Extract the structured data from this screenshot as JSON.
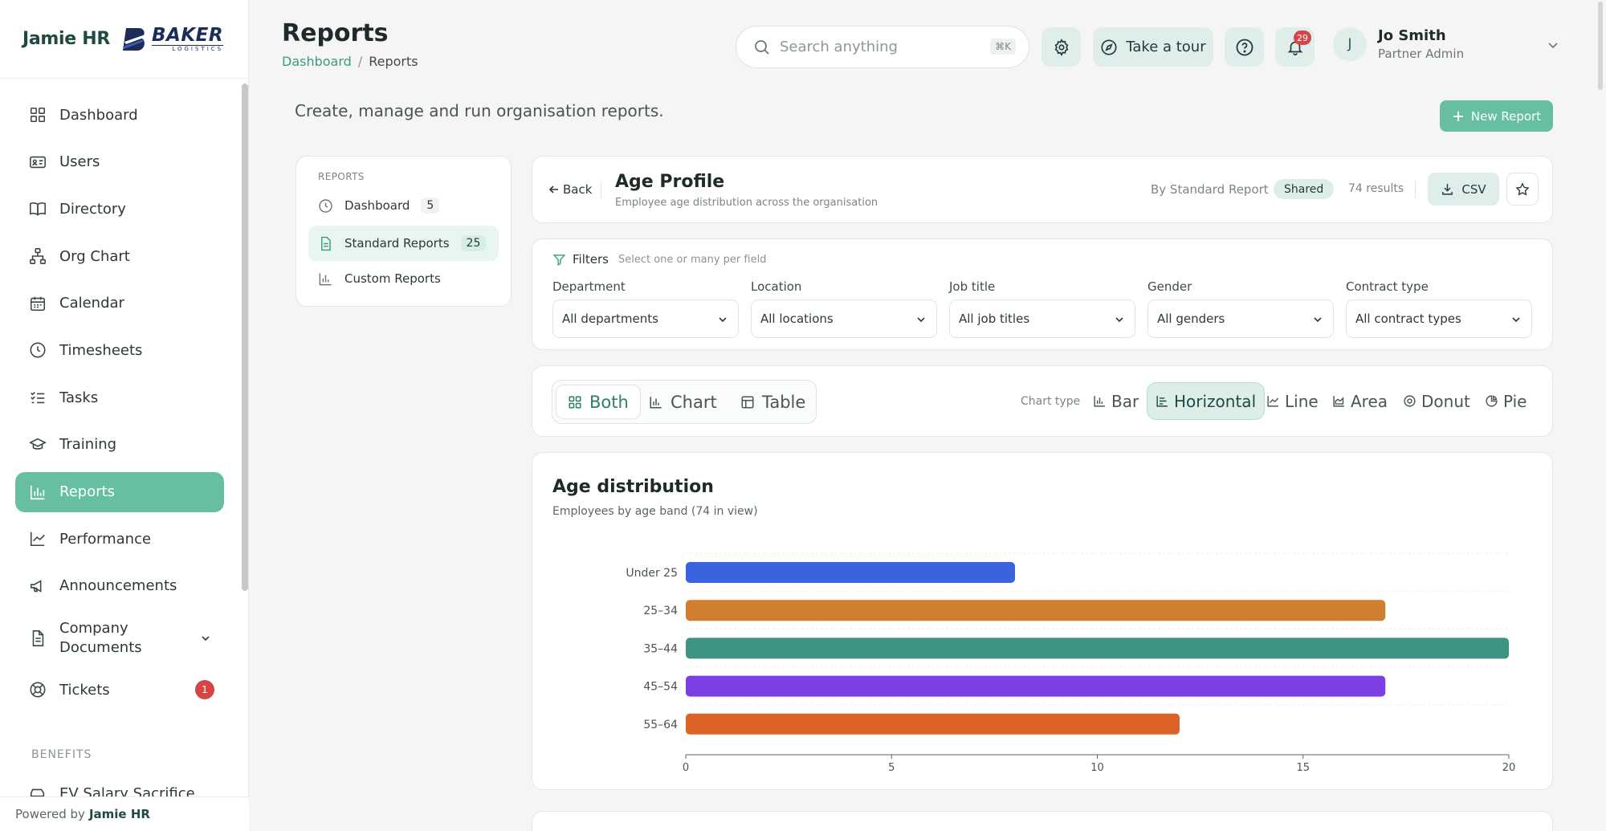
{
  "brand": {
    "name": "Jamie HR",
    "partner_logo_main": "BAKER",
    "partner_logo_sub": "LOGISTICS"
  },
  "sidebar": {
    "items": [
      {
        "label": "Dashboard",
        "icon": "grid-icon"
      },
      {
        "label": "Users",
        "icon": "id-card-icon"
      },
      {
        "label": "Directory",
        "icon": "book-icon"
      },
      {
        "label": "Org Chart",
        "icon": "org-chart-icon"
      },
      {
        "label": "Calendar",
        "icon": "calendar-icon"
      },
      {
        "label": "Timesheets",
        "icon": "clock-icon"
      },
      {
        "label": "Tasks",
        "icon": "checklist-icon"
      },
      {
        "label": "Training",
        "icon": "graduation-cap-icon"
      },
      {
        "label": "Reports",
        "icon": "bar-chart-icon",
        "active": true
      },
      {
        "label": "Performance",
        "icon": "line-chart-icon"
      },
      {
        "label": "Announcements",
        "icon": "megaphone-icon"
      },
      {
        "label": "Company Documents",
        "icon": "document-icon"
      },
      {
        "label": "Tickets",
        "icon": "lifebuoy-icon",
        "badge": "1"
      }
    ],
    "section_benefits": "BENEFITS",
    "cut_item": "EV Salary Sacrifice",
    "powered_by": "Powered by",
    "powered_brand": "Jamie HR"
  },
  "header": {
    "title": "Reports",
    "breadcrumb": [
      "Dashboard",
      "/",
      "Reports"
    ],
    "search_placeholder": "Search anything",
    "search_shortcut": "⌘K",
    "tour_label": "Take a tour",
    "notifications_count": "29",
    "user": {
      "initial": "J",
      "name": "Jo Smith",
      "role": "Partner Admin"
    }
  },
  "page": {
    "subtitle": "Create, manage and run organisation reports.",
    "new_report_label": "New Report"
  },
  "reports_nav": {
    "heading": "REPORTS",
    "items": [
      {
        "label": "Dashboard",
        "count": "5"
      },
      {
        "label": "Standard Reports",
        "count": "25",
        "active": true
      },
      {
        "label": "Custom Reports"
      }
    ]
  },
  "report": {
    "back_label": "Back",
    "title": "Age Profile",
    "description": "Employee age distribution across the organisation",
    "by": "By Standard Report",
    "shared": "Shared",
    "results": "74 results",
    "csv_label": "CSV"
  },
  "filters": {
    "title": "Filters",
    "hint": "Select one or many per field",
    "fields": [
      {
        "label": "Department",
        "value": "All departments"
      },
      {
        "label": "Location",
        "value": "All locations"
      },
      {
        "label": "Job title",
        "value": "All job titles"
      },
      {
        "label": "Gender",
        "value": "All genders"
      },
      {
        "label": "Contract type",
        "value": "All contract types"
      }
    ]
  },
  "view": {
    "modes": [
      "Both",
      "Chart",
      "Table"
    ],
    "active_mode": "Both",
    "chart_type_label": "Chart type",
    "chart_types": [
      "Bar",
      "Horizontal",
      "Line",
      "Area",
      "Donut",
      "Pie"
    ],
    "active_chart_type": "Horizontal"
  },
  "chart_panel": {
    "title": "Age distribution",
    "subtitle": "Employees by age band (74 in view)"
  },
  "chart_data": {
    "type": "bar",
    "orientation": "horizontal",
    "categories": [
      "Under 25",
      "25–34",
      "35–44",
      "45–54",
      "55–64"
    ],
    "values": [
      8,
      17,
      20,
      17,
      12
    ],
    "colors": [
      "#3b63e0",
      "#d07f2e",
      "#3d9484",
      "#7b3fe4",
      "#dc6228"
    ],
    "xlim": [
      0,
      20
    ],
    "xticks": [
      "0",
      "5",
      "10",
      "15",
      "20"
    ],
    "grid": true
  },
  "colors": {
    "accent": "#66bfa1",
    "accent_light": "#dfeeea",
    "badge_red": "#d64545"
  }
}
